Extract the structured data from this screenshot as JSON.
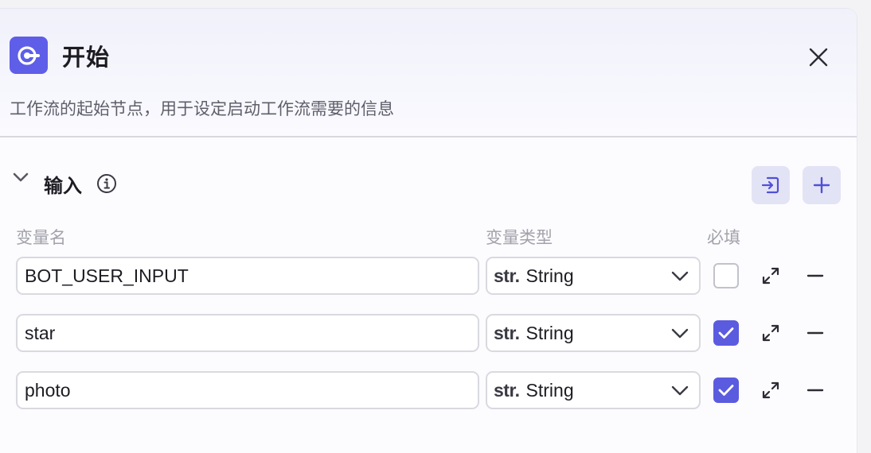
{
  "node": {
    "icon": "start-node-icon",
    "title": "开始",
    "description": "工作流的起始节点，用于设定启动工作流需要的信息",
    "close_icon": "close-icon"
  },
  "inputs_section": {
    "title": "输入",
    "expanded": true,
    "info_icon": "info-icon",
    "import_icon": "import-icon",
    "add_icon": "plus-icon",
    "columns": {
      "name": "变量名",
      "type": "变量类型",
      "required": "必填"
    },
    "rows": [
      {
        "name": "BOT_USER_INPUT",
        "type_prefix": "str.",
        "type": "String",
        "required": false
      },
      {
        "name": "star",
        "type_prefix": "str.",
        "type": "String",
        "required": true
      },
      {
        "name": "photo",
        "type_prefix": "str.",
        "type": "String",
        "required": true
      }
    ]
  },
  "colors": {
    "accent": "#5b5bdf",
    "button_bg": "#e3e3f6",
    "header_bg": "#f1f1fb"
  }
}
